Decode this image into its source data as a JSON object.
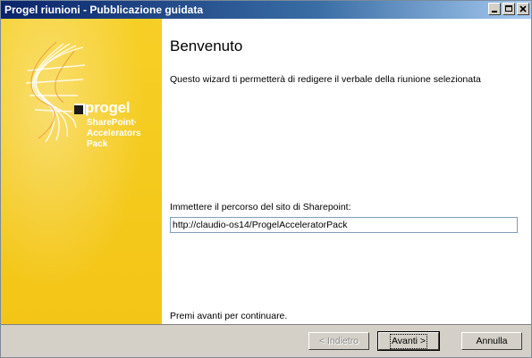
{
  "window": {
    "title": "Progel riunioni - Pubblicazione guidata"
  },
  "sidebar": {
    "brand": "progel",
    "product_line1": "SharePoint·",
    "product_line2": "Accelerators Pack"
  },
  "content": {
    "heading": "Benvenuto",
    "description": "Questo wizard ti permetterà di redigere il verbale della riunione selezionata",
    "path_label": "Immettere il percorso del sito di Sharepoint:",
    "path_value": "http://claudio-os14/ProgelAcceleratorPack",
    "footer_message": "Premi avanti per continuare."
  },
  "buttons": {
    "back": "< Indietro",
    "next": "Avanti >",
    "cancel": "Annulla"
  },
  "colors": {
    "sidebar": "#f5cb1c",
    "titlebar_start": "#0a246a",
    "titlebar_end": "#a6caf0"
  }
}
